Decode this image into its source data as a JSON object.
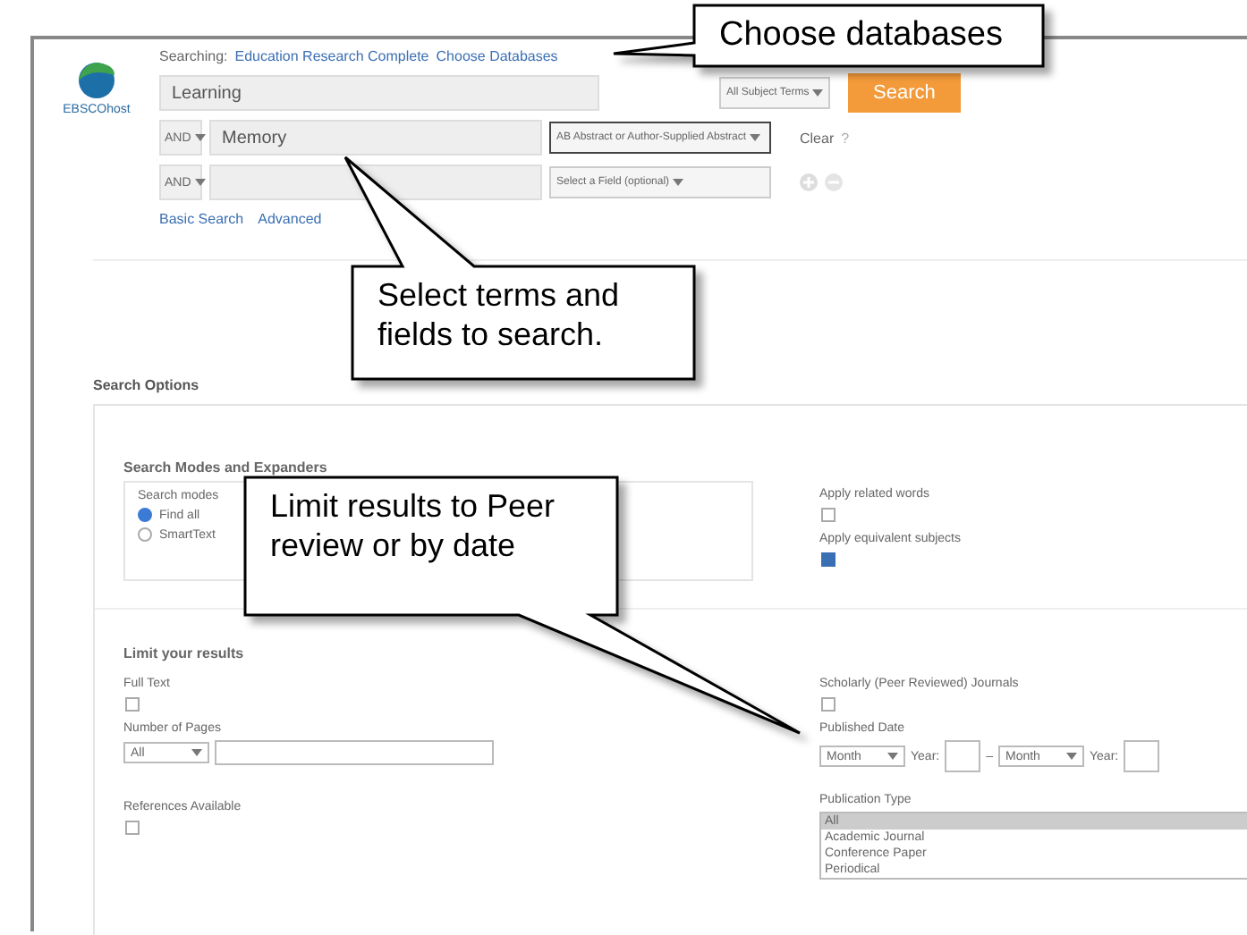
{
  "logo": {
    "text": "EBSCOhost"
  },
  "searching": {
    "label": "Searching:",
    "database": "Education Research Complete",
    "choose_link": "Choose Databases"
  },
  "search_rows": [
    {
      "kind": "first",
      "value": "Learning",
      "field": "All Subject Terms"
    },
    {
      "kind": "bool",
      "operator": "AND",
      "value": "Memory",
      "field": "AB Abstract or Author-Supplied Abstract"
    },
    {
      "kind": "bool",
      "operator": "AND",
      "field": "Select a Field (optional)"
    }
  ],
  "search_button": "Search",
  "clear_link": "Clear",
  "help": "?",
  "links": [
    "Basic Search",
    "Advanced"
  ],
  "options": {
    "title": "Search Options",
    "modes_title": "Search Modes and Expanders",
    "modes_label": "Search modes",
    "modes": [
      {
        "label": "Find all",
        "selected": true
      },
      {
        "label": "SmartText",
        "selected": false
      }
    ],
    "expanders": [
      {
        "label": "Apply related words",
        "checked": false
      },
      {
        "label": "Apply equivalent subjects",
        "checked": true
      }
    ]
  },
  "limits": {
    "title": "Limit your results",
    "full_text": {
      "label": "Full Text",
      "checked": false
    },
    "pages": {
      "label": "Number of Pages",
      "select": "All"
    },
    "references": {
      "label": "References Available",
      "checked": false
    },
    "scholarly": {
      "label": "Scholarly (Peer Reviewed) Journals",
      "checked": false
    },
    "date": {
      "label": "Published Date",
      "month_from": "Month",
      "year_label": "Year:",
      "dash": "–",
      "month_to": "Month",
      "year_label_2": "Year:"
    },
    "publication_type": {
      "label": "Publication Type",
      "items": [
        {
          "label": "All",
          "selected": true
        },
        {
          "label": "Academic Journal",
          "selected": false
        },
        {
          "label": "Conference Paper",
          "selected": false
        },
        {
          "label": "Periodical",
          "selected": false
        }
      ]
    }
  },
  "callouts": [
    {
      "text": "Choose databases"
    },
    {
      "text": "Select terms and fields to search."
    },
    {
      "text": "Limit results to Peer review or by date"
    }
  ]
}
